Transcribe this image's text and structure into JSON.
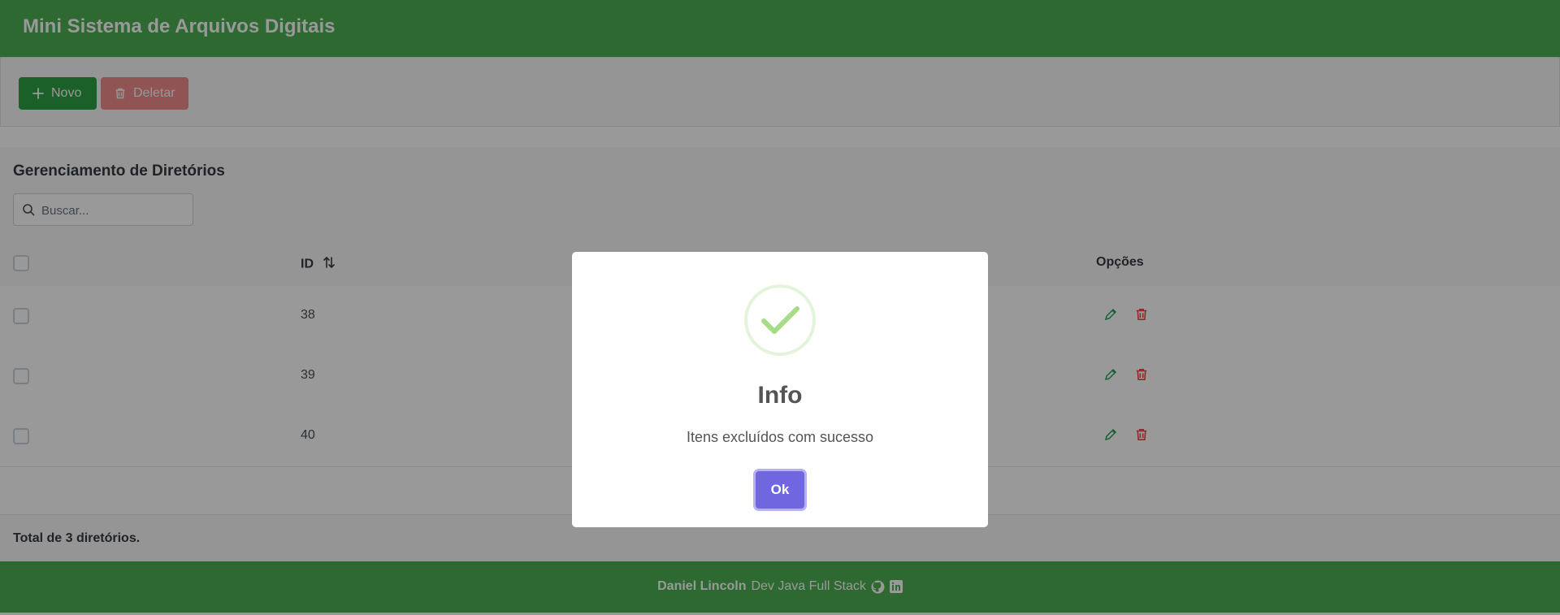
{
  "app": {
    "title": "Mini Sistema de Arquivos Digitais"
  },
  "toolbar": {
    "new_label": "Novo",
    "delete_label": "Deletar"
  },
  "section": {
    "title": "Gerenciamento de Diretórios"
  },
  "search": {
    "placeholder": "Buscar..."
  },
  "table": {
    "columns": {
      "id": "ID",
      "options": "Opções"
    },
    "rows": [
      {
        "id": "38"
      },
      {
        "id": "39"
      },
      {
        "id": "40"
      }
    ]
  },
  "summary": {
    "total": "Total de 3 diretórios."
  },
  "footer": {
    "name": "Daniel Lincoln",
    "role": "Dev Java Full Stack"
  },
  "dialog": {
    "title": "Info",
    "message": "Itens excluídos com sucesso",
    "ok_label": "Ok"
  },
  "colors": {
    "brand": "#4caf50",
    "new_button": "#2ea043",
    "delete_button": "#ef4444",
    "dialog_confirm": "#7066e0",
    "success_icon": "#a5dc86"
  },
  "icons": [
    "plus-icon",
    "trash-icon",
    "search-icon",
    "sort-icon",
    "pencil-icon",
    "github-icon",
    "linkedin-icon",
    "success-check-icon"
  ]
}
